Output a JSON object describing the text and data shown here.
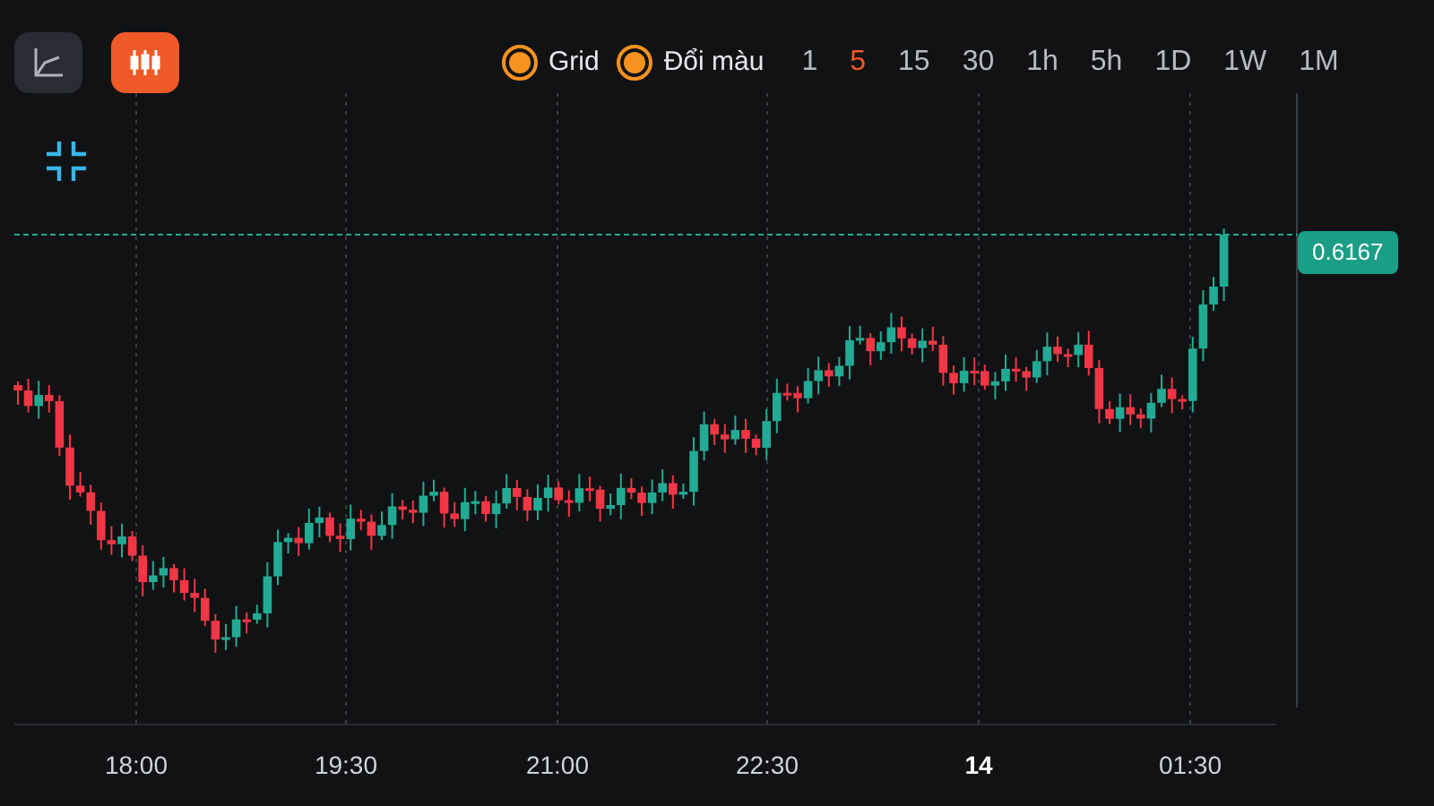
{
  "toolbar": {
    "chart_types": [
      {
        "kind": "line",
        "selected": false
      },
      {
        "kind": "candles",
        "selected": true
      }
    ],
    "toggles": [
      {
        "label": "Grid",
        "on": true
      },
      {
        "label": "Đổi màu",
        "on": true
      }
    ],
    "intervals": [
      {
        "label": "1",
        "selected": false
      },
      {
        "label": "5",
        "selected": true
      },
      {
        "label": "15",
        "selected": false
      },
      {
        "label": "30",
        "selected": false
      },
      {
        "label": "1h",
        "selected": false
      },
      {
        "label": "5h",
        "selected": false
      },
      {
        "label": "1D",
        "selected": false
      },
      {
        "label": "1W",
        "selected": false
      },
      {
        "label": "1M",
        "selected": false
      }
    ]
  },
  "chart": {
    "price_label": "0.6167",
    "x_axis": [
      {
        "label": "18:00",
        "kind": "time"
      },
      {
        "label": "19:30",
        "kind": "time"
      },
      {
        "label": "21:00",
        "kind": "time"
      },
      {
        "label": "22:30",
        "kind": "time"
      },
      {
        "label": "14",
        "kind": "day"
      },
      {
        "label": "01:30",
        "kind": "time"
      }
    ]
  }
}
